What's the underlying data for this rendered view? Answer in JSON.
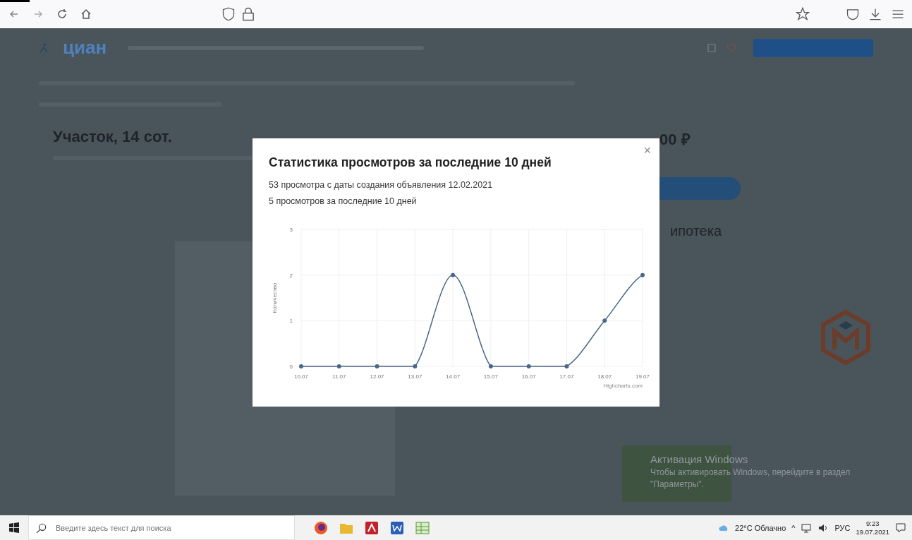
{
  "browser": {
    "nav_buttons": [
      {
        "kind": "back"
      },
      {
        "kind": "forward"
      },
      {
        "kind": "reload"
      },
      {
        "kind": "home"
      }
    ]
  },
  "site": {
    "logo": "циан",
    "listing_title": "Участок, 14 сот.",
    "price": "00 ₽",
    "mortgage_heading": "ипотека"
  },
  "modal": {
    "title": "Статистика просмотров за последние 10 дней",
    "total_views": "53 просмотра с даты создания объявления 12.02.2021",
    "recent_views": "5 просмотров за последние 10 дней",
    "close": "×",
    "chart_data": {
      "type": "line",
      "ylabel": "Количество",
      "categories": [
        "10.07",
        "11.07",
        "12.07",
        "13.07",
        "14.07",
        "15.07",
        "16.07",
        "17.07",
        "18.07",
        "19.07"
      ],
      "series": [
        {
          "color": "#4a6787",
          "marker": true,
          "values": [
            0,
            0,
            0,
            0,
            2,
            0,
            0,
            0,
            1,
            2
          ]
        }
      ],
      "ylim": [
        0,
        3
      ],
      "yticks": [
        0,
        1,
        2,
        3
      ],
      "grid": true
    },
    "credit": "Highcharts.com"
  },
  "os_notice": {
    "title": "Активация Windows",
    "text": "Чтобы активировать Windows, перейдите в раздел",
    "text2": "\"Параметры\"."
  },
  "taskbar": {
    "search_placeholder": "Введите здесь текст для поиска",
    "apps": [
      {
        "kind": "firefox"
      },
      {
        "kind": "folder"
      },
      {
        "kind": "pdf"
      },
      {
        "kind": "word"
      },
      {
        "kind": "sheet"
      }
    ],
    "weather": "22°C Облачно",
    "tray_caret": "^",
    "language": "РУС",
    "time": "9:23",
    "date": "19.07.2021"
  }
}
